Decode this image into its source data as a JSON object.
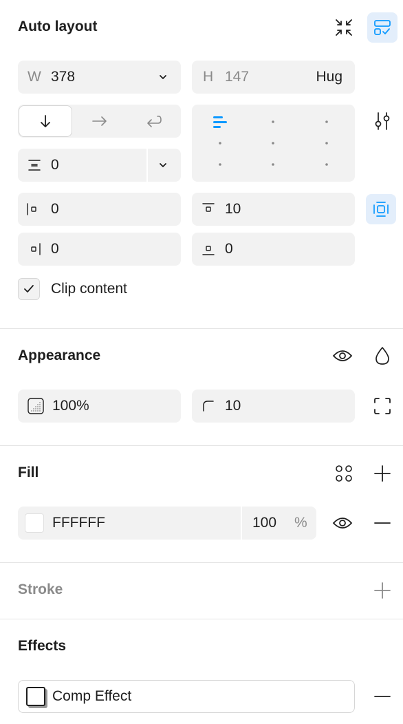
{
  "auto_layout": {
    "title": "Auto layout",
    "icons": [
      "collapse-icon",
      "layout-suggestion-icon"
    ],
    "width": {
      "label": "W",
      "value": "378"
    },
    "height": {
      "label": "H",
      "value": "147",
      "mode": "Hug"
    },
    "direction": {
      "selected": "vertical",
      "options": [
        "vertical",
        "horizontal",
        "wrap"
      ]
    },
    "gap": {
      "value": "0"
    },
    "alignment": {
      "selected": "top-left"
    },
    "padding": {
      "left": "0",
      "top": "10",
      "right": "0",
      "bottom": "0"
    },
    "clip_content": {
      "label": "Clip content",
      "checked": true
    }
  },
  "appearance": {
    "title": "Appearance",
    "opacity": "100%",
    "corner_radius": "10"
  },
  "fill": {
    "title": "Fill",
    "color_hex": "FFFFFF",
    "opacity": "100",
    "percent_sign": "%",
    "swatch_color": "#FFFFFF"
  },
  "stroke": {
    "title": "Stroke"
  },
  "effects": {
    "title": "Effects",
    "items": [
      {
        "label": "Comp Effect"
      }
    ]
  },
  "colors": {
    "accent": "#0d99ff",
    "active_bg": "#e3eefb",
    "field_bg": "#f2f2f2"
  }
}
